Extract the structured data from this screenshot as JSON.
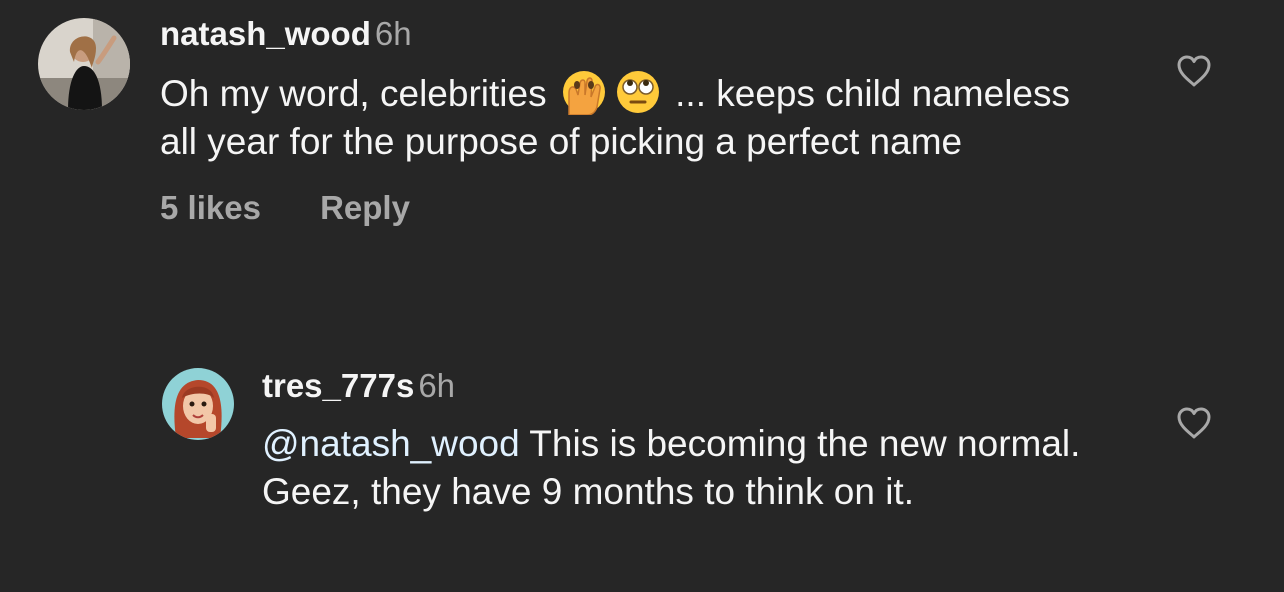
{
  "comment": {
    "username": "natash_wood",
    "time": "6h",
    "text_before_emoji": "Oh my word, celebrities",
    "emoji_1": "face-with-hand-over-mouth-icon",
    "emoji_2": "face-with-rolling-eyes-icon",
    "text_after_emoji": " ... keeps child nameless all year for the purpose of picking a perfect name",
    "likes": "5 likes",
    "reply_label": "Reply"
  },
  "reply": {
    "username": "tres_777s",
    "time": "6h",
    "mention": "@natash_wood",
    "text": " This is becoming the new normal. Geez, they have 9 months to think on it."
  },
  "colors": {
    "background": "#262626",
    "text": "#f5f5f5",
    "secondary": "#a8a8a8",
    "mention": "#e0f1ff"
  }
}
